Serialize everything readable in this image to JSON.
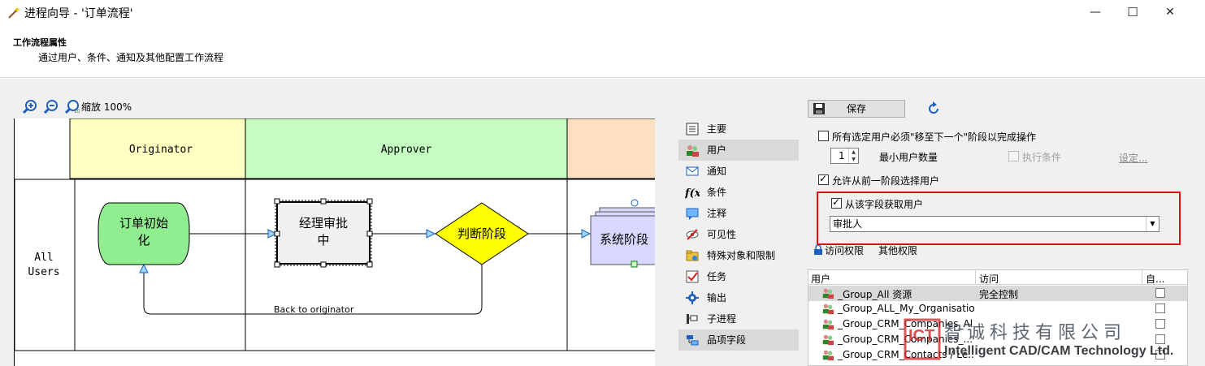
{
  "window": {
    "title": "进程向导 - '订单流程'",
    "minimize": "—",
    "maximize": "☐",
    "close": "✕"
  },
  "header": {
    "title": "工作流程属性",
    "description": "通过用户、条件、通知及其他配置工作流程"
  },
  "zoom": {
    "label": "缩放 100%"
  },
  "diagram": {
    "lanes": [
      "Originator",
      "Approver",
      ""
    ],
    "lane_colors": [
      "#ffffc2",
      "#c4fcc2",
      "#fde0c2"
    ],
    "row_label": "All Users",
    "row_label_lines": [
      "All",
      "Users"
    ],
    "nodes": {
      "start": [
        "订单初始",
        "化"
      ],
      "manager": [
        "经理审批",
        "中"
      ],
      "decision": "判断阶段",
      "system": "系统阶段"
    },
    "back_label": "Back to originator"
  },
  "nav": {
    "items": [
      {
        "label": "主要",
        "icon": "properties-icon",
        "selected": false
      },
      {
        "label": "用户",
        "icon": "users-icon",
        "selected": true
      },
      {
        "label": "通知",
        "icon": "mail-icon",
        "selected": false
      },
      {
        "label": "条件",
        "icon": "function-icon",
        "selected": false
      },
      {
        "label": "注释",
        "icon": "comment-icon",
        "selected": false
      },
      {
        "label": "可见性",
        "icon": "visibility-icon",
        "selected": false
      },
      {
        "label": "特殊对象和限制",
        "icon": "folder-icon",
        "selected": false
      },
      {
        "label": "任务",
        "icon": "task-icon",
        "selected": false
      },
      {
        "label": "输出",
        "icon": "gear-icon",
        "selected": false
      },
      {
        "label": "子进程",
        "icon": "subprocess-icon",
        "selected": false
      },
      {
        "label": "品项字段",
        "icon": "fields-icon",
        "selected": true
      }
    ]
  },
  "panel": {
    "save_label": "保存",
    "all_users_must_move": "所有选定用户必须\"移至下一个\"阶段以完成操作",
    "min_users_value": "1",
    "min_users_label": "最小用户数量",
    "exec_condition": "执行条件",
    "settings_link": "设定...",
    "allow_prev_stage": "允许从前一阶段选择用户",
    "from_field": "从该字段获取用户",
    "field_value": "审批人",
    "tabs": [
      "访问权限",
      "其他权限"
    ],
    "grid": {
      "columns": [
        "用户",
        "访问",
        "自..."
      ],
      "rows": [
        {
          "user": "_Group_All 资源",
          "access": "完全控制",
          "selected": true
        },
        {
          "user": "_Group_ALL_My_Organisatio...",
          "access": "",
          "selected": false
        },
        {
          "user": "_Group_CRM_Companies_Al...",
          "access": "",
          "selected": false
        },
        {
          "user": "_Group_CRM_Companies_...",
          "access": "",
          "selected": false
        },
        {
          "user": "_Group_CRM_Contacts / Le...",
          "access": "",
          "selected": false
        }
      ]
    }
  },
  "watermark": {
    "cn": "智诚科技有限公司",
    "en": "Intelligent CAD/CAM Technology Ltd."
  },
  "colors": {
    "highlight": "#e01010",
    "start_node": "#90ee90",
    "decision_node": "#ffff00",
    "system_node": "#d8d8ff"
  }
}
